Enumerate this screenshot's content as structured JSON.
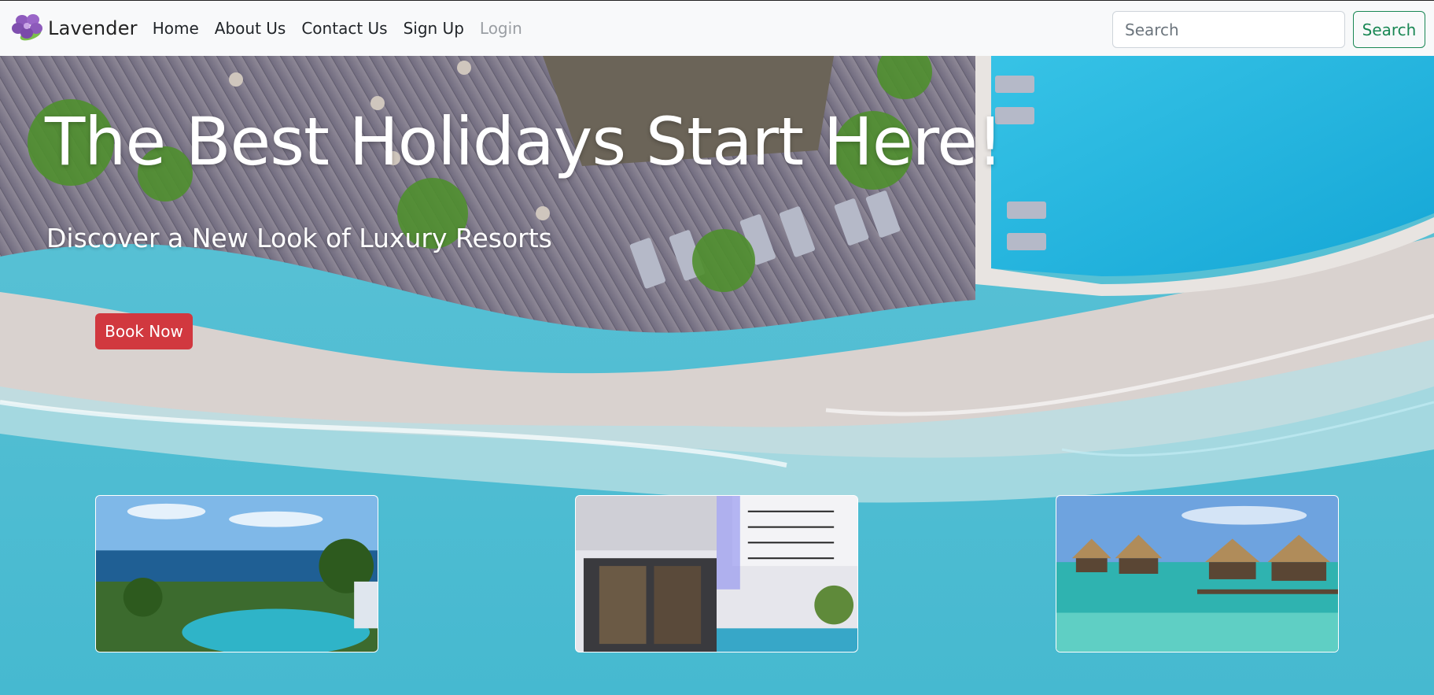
{
  "brand": {
    "name": "Lavender",
    "logo_icon": "lavender-flower-icon"
  },
  "nav": {
    "items": [
      {
        "label": "Home",
        "disabled": false
      },
      {
        "label": "About Us",
        "disabled": false
      },
      {
        "label": "Contact Us",
        "disabled": false
      },
      {
        "label": "Sign Up",
        "disabled": false
      },
      {
        "label": "Login",
        "disabled": true
      }
    ]
  },
  "search": {
    "placeholder": "Search",
    "button_label": "Search"
  },
  "hero": {
    "title": "The Best Holidays Start Here!",
    "subtitle": "Discover a New Look of Luxury Resorts",
    "cta_label": "Book Now"
  },
  "cards": [
    {
      "image": "cliffside-resort-pool-photo"
    },
    {
      "image": "modern-villa-courtyard-photo"
    },
    {
      "image": "overwater-bungalows-photo"
    }
  ],
  "colors": {
    "navbar_bg": "#f8f9fa",
    "search_button": "#198754",
    "cta_button": "#d1383f",
    "disabled_link": "#9a9ea3"
  }
}
